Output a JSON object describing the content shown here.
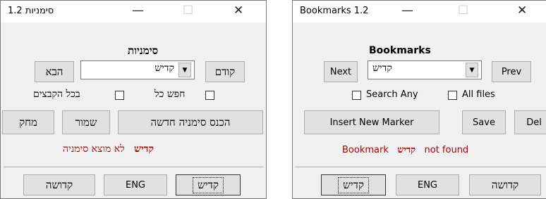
{
  "hebrew_window": {
    "title": "סימניות 1.2",
    "minimize": "—",
    "maximize": "☐",
    "close": "✕",
    "heading": "סימניות",
    "prev_label": "הבא",
    "next_label": "קודם",
    "combo_value": "קדיש",
    "search_any_label": "חפש כל",
    "all_files_label": "בכל הקבצים",
    "delete_label": "מחק",
    "save_label": "שמור",
    "insert_label": "הכנס סימניה חדשה",
    "status_prefix": "לא מוצא סימניה",
    "status_word": "קדיש",
    "bottom": [
      "קדושה",
      "ENG",
      "קדיש"
    ]
  },
  "english_window": {
    "title": "Bookmarks  1.2",
    "minimize": "—",
    "maximize": "☐",
    "close": "✕",
    "heading": "Bookmarks",
    "next_label": "Next",
    "prev_label": "Prev",
    "combo_value": "קדיש",
    "search_any_label": "Search Any",
    "all_files_label": "All files",
    "insert_label": "Insert New Marker",
    "save_label": "Save",
    "delete_label": "Del",
    "status_prefix": "Bookmark",
    "status_word": "קדיש",
    "status_suffix": "not found",
    "bottom": [
      "קדיש",
      "ENG",
      "קדושה"
    ]
  },
  "icons": {
    "dropdown": "triangle-down",
    "checkbox": "unchecked-box"
  },
  "colors": {
    "status_text": "#b00000",
    "window_bg": "#f0f0f0",
    "button_bg": "#e1e1e1"
  }
}
